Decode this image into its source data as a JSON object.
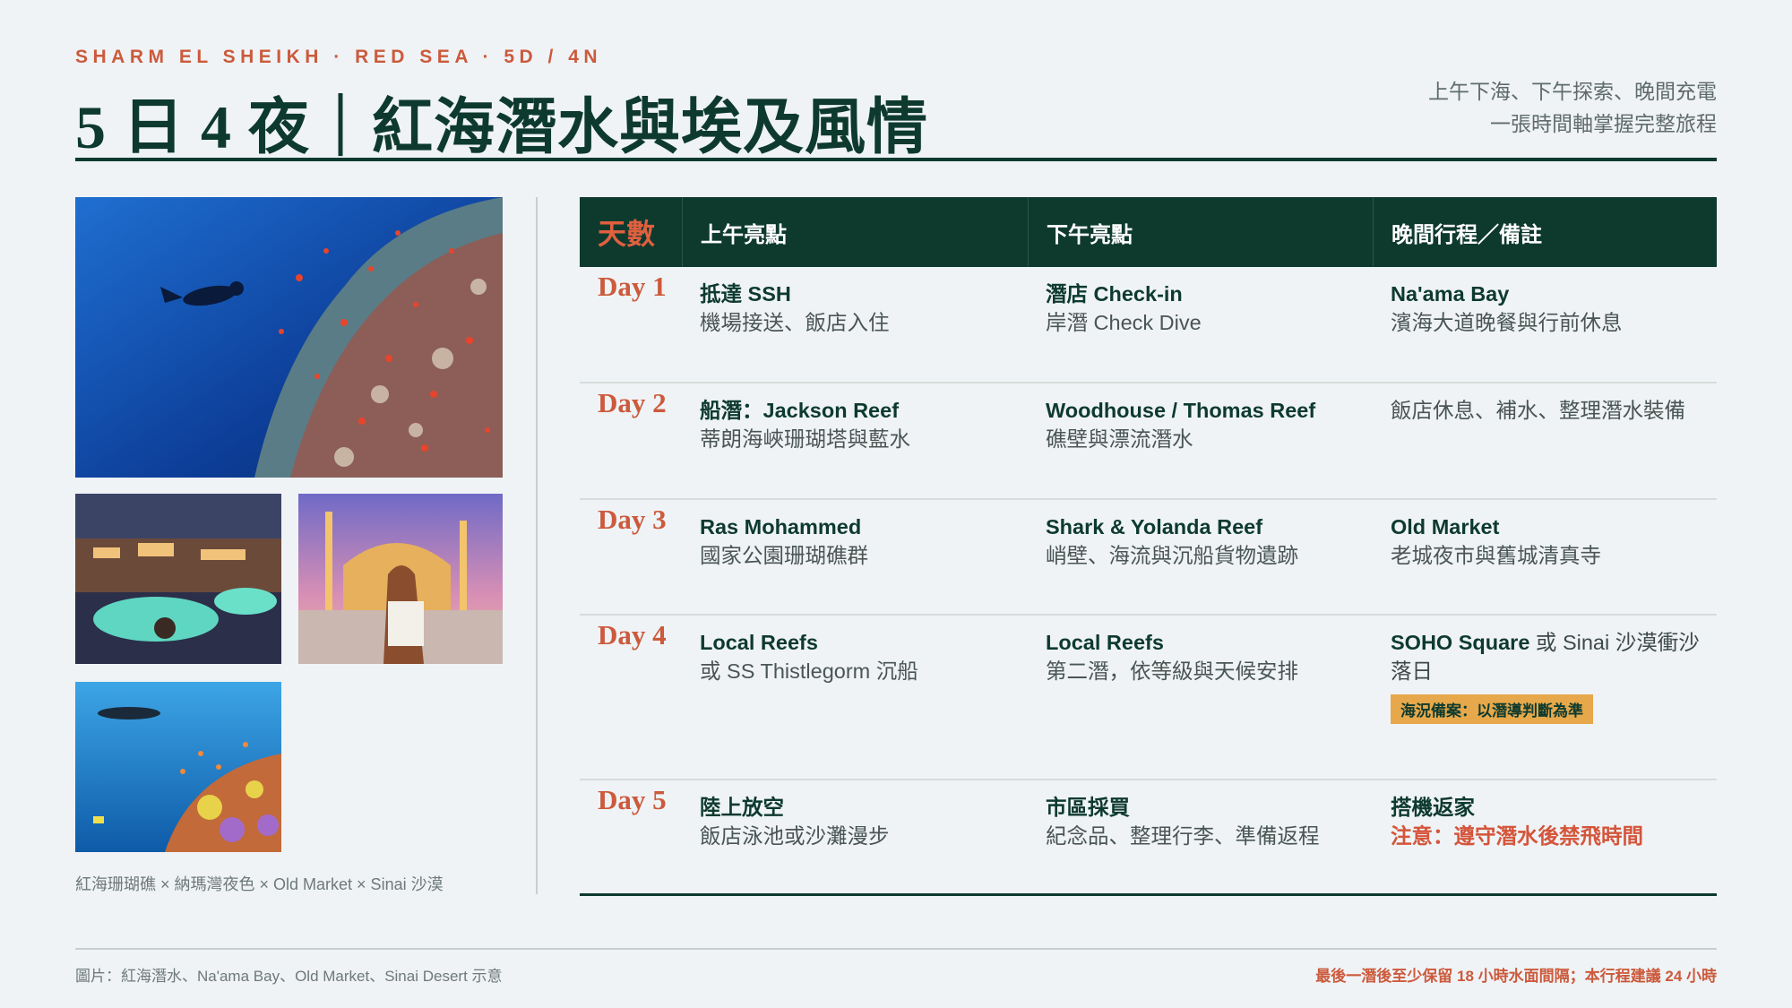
{
  "header": {
    "kicker": "SHARM EL SHEIKH · RED SEA · 5D / 4N",
    "title": "5 日 4 夜｜紅海潛水與埃及風情",
    "tagline_line1": "上午下海、下午探索、晚間充電",
    "tagline_line2": "一張時間軸掌握完整旅程"
  },
  "gallery": {
    "caption": "紅海珊瑚礁 × 納瑪灣夜色 × Old Market × Sinai 沙漠"
  },
  "table": {
    "headers": [
      "天數",
      "上午亮點",
      "下午亮點",
      "晚間行程／備註"
    ],
    "rows": [
      {
        "day": "Day 1",
        "morning": {
          "title": "抵達 SSH",
          "sub": "機場接送、飯店入住"
        },
        "afternoon": {
          "title": "潛店 Check-in",
          "sub": "岸潛 Check Dive"
        },
        "evening": {
          "title": "Na'ama Bay",
          "sub": "濱海大道晚餐與行前休息"
        }
      },
      {
        "day": "Day 2",
        "morning": {
          "title": "船潛：Jackson Reef",
          "sub": "蒂朗海峽珊瑚塔與藍水"
        },
        "afternoon": {
          "title": "Woodhouse / Thomas Reef",
          "sub": "礁壁與漂流潛水"
        },
        "evening": {
          "title": "",
          "sub": "飯店休息、補水、整理潛水裝備"
        }
      },
      {
        "day": "Day 3",
        "morning": {
          "title": "Ras Mohammed",
          "sub": "國家公園珊瑚礁群"
        },
        "afternoon": {
          "title": "Shark & Yolanda Reef",
          "sub": "峭壁、海流與沉船貨物遺跡"
        },
        "evening": {
          "title": "Old Market",
          "sub": "老城夜市與舊城清真寺"
        }
      },
      {
        "day": "Day 4",
        "morning": {
          "title": "Local Reefs",
          "sub": "或 SS Thistlegorm 沉船"
        },
        "afternoon": {
          "title": "Local Reefs",
          "sub": "第二潛，依等級與天候安排"
        },
        "evening": {
          "title": "SOHO Square",
          "title_suffix": " 或 Sinai 沙漠衝沙落日",
          "badge": "海況備案：以潛導判斷為準"
        }
      },
      {
        "day": "Day 5",
        "morning": {
          "title": "陸上放空",
          "sub": "飯店泳池或沙灘漫步"
        },
        "afternoon": {
          "title": "市區採買",
          "sub": "紀念品、整理行李、準備返程"
        },
        "evening": {
          "title": "搭機返家",
          "sub": "注意：遵守潛水後禁飛時間"
        }
      }
    ]
  },
  "footer": {
    "credit": "圖片：紅海潛水、Na'ama Bay、Old Market、Sinai Desert 示意",
    "note": "最後一潛後至少保留 18 小時水面間隔；本行程建議 24 小時"
  },
  "colors": {
    "accent": "#cc5a3c",
    "primary": "#0e3a2e",
    "badge": "#e6a84a",
    "background": "#eff3f6"
  }
}
